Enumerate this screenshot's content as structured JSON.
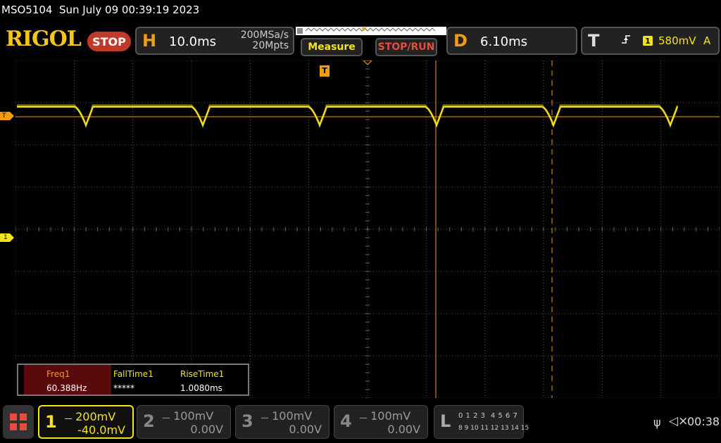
{
  "header": {
    "model": "MSO5104",
    "datetime": "Sun July 09 00:39:19 2023",
    "logo": "RIGOL",
    "run_state": "STOP"
  },
  "horizontal": {
    "letter": "H",
    "timebase": "10.0ms",
    "sample_rate": "200MSa/s",
    "memory_depth": "20Mpts"
  },
  "buttons": {
    "measure": "Measure",
    "stop_run": "STOP/RUN"
  },
  "delay": {
    "letter": "D",
    "value": "6.10ms"
  },
  "trigger": {
    "letter": "T",
    "channel": "1",
    "level": "580mV",
    "mode": "A",
    "edge_icon": "rising-edge-icon"
  },
  "markers": {
    "trigger_level": "T",
    "ch1_ground": "1"
  },
  "measurements": {
    "headers": [
      "Freq1",
      "FallTime1",
      "RiseTime1"
    ],
    "values": [
      "60.388Hz",
      "*****",
      "1.0080ms"
    ]
  },
  "channels": [
    {
      "num": "1",
      "scale": "200mV",
      "offset": "-40.0mV",
      "color": "#f5e31a",
      "active": true
    },
    {
      "num": "2",
      "scale": "100mV",
      "offset": "0.00V",
      "color": "#888888",
      "active": false
    },
    {
      "num": "3",
      "scale": "100mV",
      "offset": "0.00V",
      "color": "#888888",
      "active": false
    },
    {
      "num": "4",
      "scale": "100mV",
      "offset": "0.00V",
      "color": "#888888",
      "active": false
    }
  ],
  "logic": {
    "letter": "L",
    "row1": "0 1 2 3  4 5 6 7",
    "row2": "8 9 10 11 12 13 14 15"
  },
  "status": {
    "time": "00:38"
  },
  "colors": {
    "trace": "#f5e31a",
    "cursor": "#f39c12",
    "grid": "#555555"
  }
}
